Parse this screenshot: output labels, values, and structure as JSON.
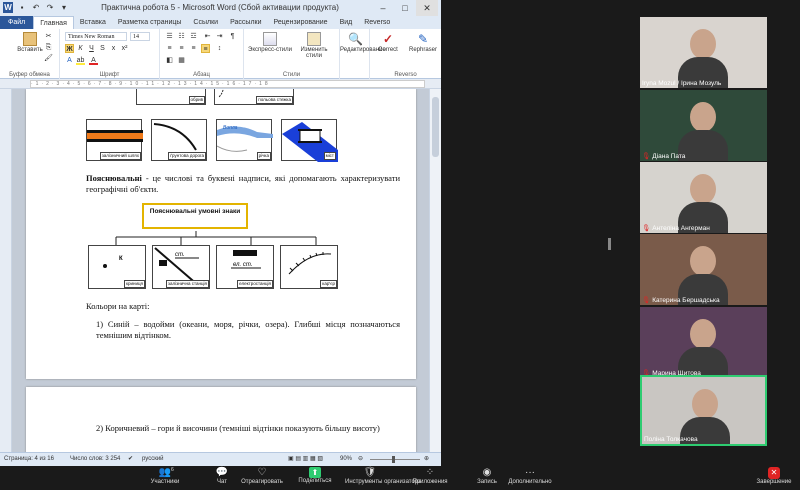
{
  "word": {
    "title": "Практична робота 5 - Microsoft Word (Сбой активации продукта)",
    "tabs": [
      "Файл",
      "Главная",
      "Вставка",
      "Разметка страницы",
      "Ссылки",
      "Рассылки",
      "Рецензирование",
      "Вид",
      "Reverso"
    ],
    "ribbon": {
      "paste_label": "Вставить",
      "font_name": "Times New Roman",
      "font_size": "14",
      "express_styles": "Экспресс-стили",
      "change_styles": "Изменить стили",
      "editing": "Редактирование",
      "correct": "Correct",
      "rephraser": "Rephraser",
      "groups": {
        "clipboard": "Буфер обмена",
        "font": "Шрифт",
        "paragraph": "Абзац",
        "styles": "Стили",
        "reverso": "Reverso"
      }
    },
    "doc": {
      "top_captions": [
        "обрив",
        "польова стежка"
      ],
      "map_captions": [
        "залізничний шлях",
        "ґрунтова дорога",
        "річка",
        "міст"
      ],
      "bold_term": "Пояснювальні",
      "para1_rest": " - це числові та буквені надписи, які допомагають характеризувати географічні об'єкти.",
      "legend_title": "Пояснювальні умовні знаки",
      "sign_captions": [
        "криниця",
        "залізнична станція",
        "електростанція",
        "кар'єр"
      ],
      "sign_texts": [
        "К",
        "ст.",
        "ел. ст."
      ],
      "colors_heading": "Кольори на карті:",
      "item1": "1) Синій – водойми (океани, моря, річки, озера). Глибші місця позначаються темнішим відтінком.",
      "item2": "2) Коричневий – гори й височини (темніші відтінки показують більшу висоту)"
    },
    "status": {
      "page": "Страница: 4 из 16",
      "words": "Число слов: 3 254",
      "lang": "русский",
      "zoom": "90%"
    }
  },
  "participants": [
    {
      "name": "Iryna Mozul / Ірина Мозуль",
      "muted": false,
      "bg": "#d9d4cf",
      "active": false
    },
    {
      "name": "Діана Пата",
      "muted": true,
      "bg": "#2f4a3a",
      "active": false
    },
    {
      "name": "Антеліна Ангерман",
      "muted": true,
      "bg": "#d6d3ce",
      "active": false
    },
    {
      "name": "Катерина Бершадська",
      "muted": true,
      "bg": "#7a5b4a",
      "active": false
    },
    {
      "name": "Марина Щитова",
      "muted": true,
      "bg": "#5a3f5a",
      "active": false
    },
    {
      "name": "Поліна Толкачова",
      "muted": false,
      "bg": "#c9c6c2",
      "active": true
    }
  ],
  "toolbar": [
    {
      "label": "Участники",
      "icon": "participants-icon",
      "count": "6"
    },
    {
      "label": "Чат",
      "icon": "chat-icon"
    },
    {
      "label": "Отреагировать",
      "icon": "react-icon"
    },
    {
      "label": "Поделиться",
      "icon": "share-icon"
    },
    {
      "label": "Инструменты организатора",
      "icon": "host-tools-icon"
    },
    {
      "label": "Приложения",
      "icon": "apps-icon"
    },
    {
      "label": "Запись",
      "icon": "record-icon"
    },
    {
      "label": "Дополнительно",
      "icon": "more-icon"
    },
    {
      "label": "Завершение",
      "icon": "end-icon"
    }
  ]
}
